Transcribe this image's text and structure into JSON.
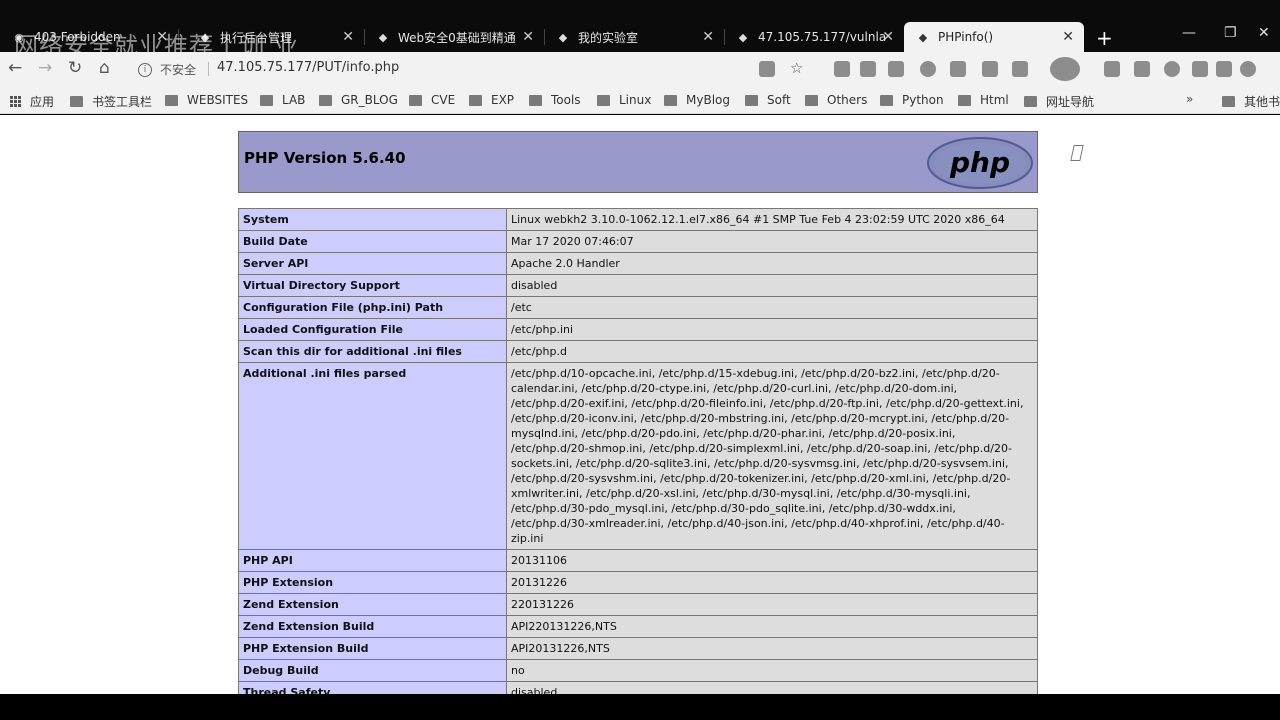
{
  "tabs": [
    {
      "title": "403 Forbidden",
      "active": false
    },
    {
      "title": "执行后台管理",
      "active": false
    },
    {
      "title": "Web安全0基础到精通",
      "active": false
    },
    {
      "title": "我的实验室",
      "active": false
    },
    {
      "title": "47.105.75.177/vulnla",
      "active": false
    },
    {
      "title": "PHPinfo()",
      "active": true
    }
  ],
  "overlay_text": "网络安全就业推荐 | 训 业",
  "window_controls": {
    "minimize": "—",
    "maximize": "❐",
    "close": "✕"
  },
  "new_tab": "+",
  "addressbar": {
    "security_label": "不安全",
    "url": "47.105.75.177/PUT/info.php"
  },
  "nav": {
    "back": "←",
    "forward": "→",
    "reload": "↻",
    "home": "⌂"
  },
  "bookmarks": {
    "apps_label": "应用",
    "items": [
      "书签工具栏",
      "WEBSITES",
      "LAB",
      "GR_BLOG",
      "CVE",
      "EXP",
      "Tools",
      "Linux",
      "MyBlog",
      "Soft",
      "Others",
      "Python",
      "Html",
      "网址导航"
    ],
    "overflow": "»",
    "other": "其他书签"
  },
  "phpinfo": {
    "version_title": "PHP Version 5.6.40",
    "logo_text": "php",
    "rows": [
      {
        "key": "System",
        "value": "Linux webkh2 3.10.0-1062.12.1.el7.x86_64 #1 SMP Tue Feb 4 23:02:59 UTC 2020 x86_64"
      },
      {
        "key": "Build Date",
        "value": "Mar 17 2020 07:46:07"
      },
      {
        "key": "Server API",
        "value": "Apache 2.0 Handler"
      },
      {
        "key": "Virtual Directory Support",
        "value": "disabled"
      },
      {
        "key": "Configuration File (php.ini) Path",
        "value": "/etc"
      },
      {
        "key": "Loaded Configuration File",
        "value": "/etc/php.ini"
      },
      {
        "key": "Scan this dir for additional .ini files",
        "value": "/etc/php.d"
      },
      {
        "key": "Additional .ini files parsed",
        "value": "/etc/php.d/10-opcache.ini, /etc/php.d/15-xdebug.ini, /etc/php.d/20-bz2.ini, /etc/php.d/20-calendar.ini, /etc/php.d/20-ctype.ini, /etc/php.d/20-curl.ini, /etc/php.d/20-dom.ini, /etc/php.d/20-exif.ini, /etc/php.d/20-fileinfo.ini, /etc/php.d/20-ftp.ini, /etc/php.d/20-gettext.ini, /etc/php.d/20-iconv.ini, /etc/php.d/20-mbstring.ini, /etc/php.d/20-mcrypt.ini, /etc/php.d/20-mysqlnd.ini, /etc/php.d/20-pdo.ini, /etc/php.d/20-phar.ini, /etc/php.d/20-posix.ini, /etc/php.d/20-shmop.ini, /etc/php.d/20-simplexml.ini, /etc/php.d/20-soap.ini, /etc/php.d/20-sockets.ini, /etc/php.d/20-sqlite3.ini, /etc/php.d/20-sysvmsg.ini, /etc/php.d/20-sysvsem.ini, /etc/php.d/20-sysvshm.ini, /etc/php.d/20-tokenizer.ini, /etc/php.d/20-xml.ini, /etc/php.d/20-xmlwriter.ini, /etc/php.d/20-xsl.ini, /etc/php.d/30-mysql.ini, /etc/php.d/30-mysqli.ini, /etc/php.d/30-pdo_mysql.ini, /etc/php.d/30-pdo_sqlite.ini, /etc/php.d/30-wddx.ini, /etc/php.d/30-xmlreader.ini, /etc/php.d/40-json.ini, /etc/php.d/40-xhprof.ini, /etc/php.d/40-zip.ini"
      },
      {
        "key": "PHP API",
        "value": "20131106"
      },
      {
        "key": "PHP Extension",
        "value": "20131226"
      },
      {
        "key": "Zend Extension",
        "value": "220131226"
      },
      {
        "key": "Zend Extension Build",
        "value": "API220131226,NTS"
      },
      {
        "key": "PHP Extension Build",
        "value": "API20131226,NTS"
      },
      {
        "key": "Debug Build",
        "value": "no"
      },
      {
        "key": "Thread Safety",
        "value": "disabled"
      }
    ]
  },
  "colors": {
    "header_bg": "#9999cc",
    "key_bg": "#ccccff",
    "value_bg": "#dddddd"
  }
}
